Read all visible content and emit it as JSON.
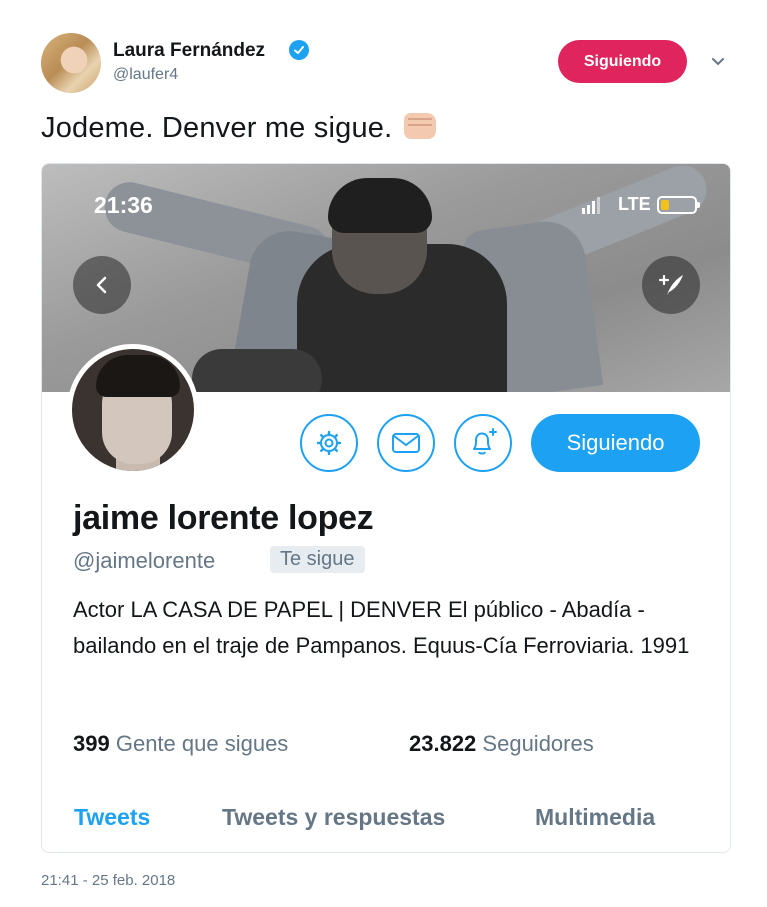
{
  "tweet": {
    "author_name": "Laura Fernández",
    "author_handle": "@laufer4",
    "follow_label": "Siguiendo",
    "text": "Jodeme. Denver me sigue.",
    "timestamp": "21:41 - 25 feb. 2018",
    "colors": {
      "follow_button": "#e0245e",
      "verified": "#1da1f2"
    }
  },
  "screenshot": {
    "status": {
      "time": "21:36",
      "network": "LTE",
      "battery_level": 0.25
    },
    "profile": {
      "name": "jaime lorente lopez",
      "handle": "@jaimelorente",
      "follows_you_badge": "Te sigue",
      "following_label": "Siguiendo",
      "bio": "Actor LA CASA DE PAPEL | DENVER El público - Abadía - bailando en el traje de Pampanos. Equus-Cía Ferroviaria. 1991",
      "following_count": "399",
      "following_label_text": "Gente que sigues",
      "followers_count": "23.822",
      "followers_label_text": "Seguidores"
    },
    "tabs": [
      "Tweets",
      "Tweets y respuestas",
      "Multimedia"
    ],
    "active_tab": 0,
    "icons": [
      "chevron-left-icon",
      "compose-icon",
      "gear-icon",
      "mail-icon",
      "bell-plus-icon"
    ],
    "accent": "#1da1f2"
  }
}
